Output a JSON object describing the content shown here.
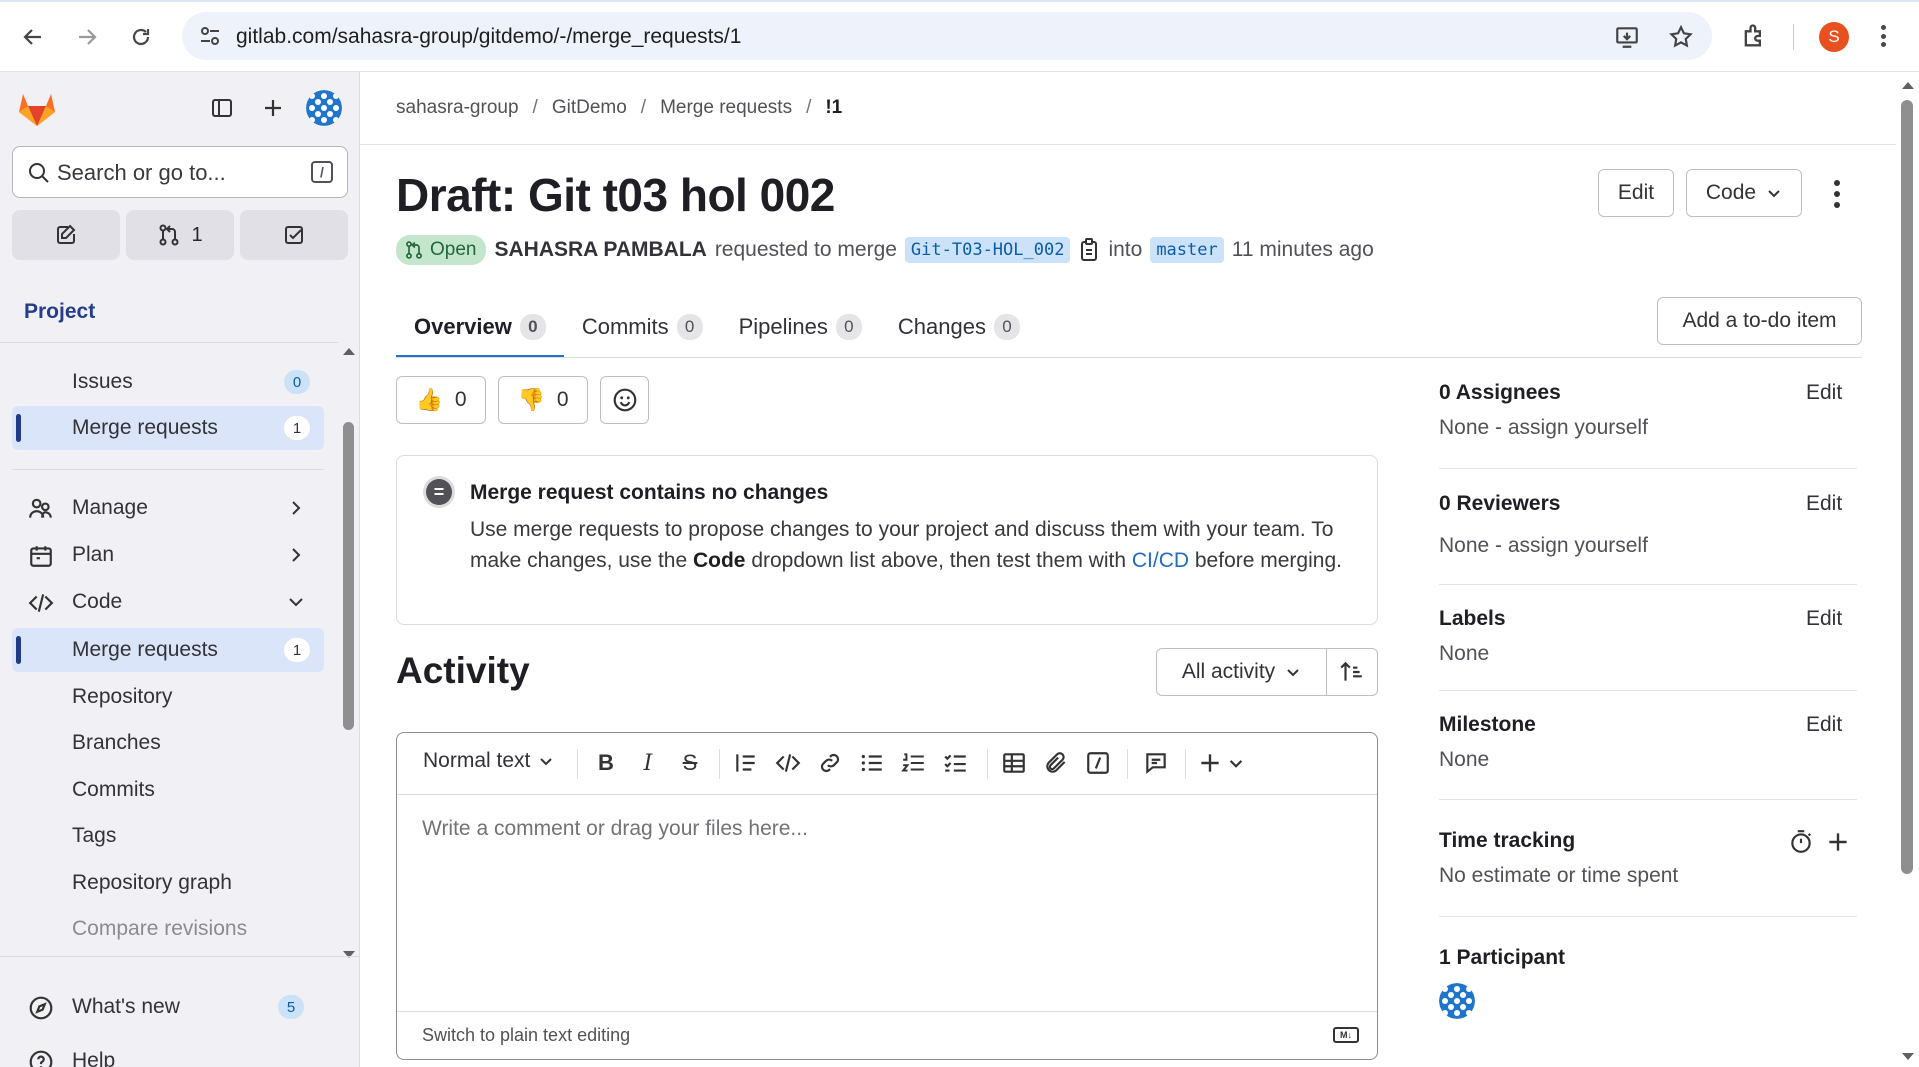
{
  "browser": {
    "url": "gitlab.com/sahasra-group/gitdemo/-/merge_requests/1",
    "profile_initial": "S",
    "icons": [
      "back-icon",
      "forward-icon",
      "reload-icon",
      "site-settings-icon",
      "install-icon",
      "bookmark-star-icon",
      "extensions-icon",
      "chrome-menu-icon"
    ]
  },
  "sidebar": {
    "search_placeholder": "Search or go to...",
    "search_shortcut": "/",
    "mr_count": "1",
    "section_label": "Project",
    "items": [
      {
        "label": "Issues",
        "badge": "0"
      },
      {
        "label": "Merge requests",
        "badge": "1"
      },
      {
        "label": "Manage"
      },
      {
        "label": "Plan"
      },
      {
        "label": "Code"
      },
      {
        "label": "Merge requests",
        "badge": "1"
      },
      {
        "label": "Repository"
      },
      {
        "label": "Branches"
      },
      {
        "label": "Commits"
      },
      {
        "label": "Tags"
      },
      {
        "label": "Repository graph"
      },
      {
        "label": "Compare revisions"
      }
    ],
    "whats_new": {
      "label": "What's new",
      "badge": "5"
    },
    "help": {
      "label": "Help"
    }
  },
  "breadcrumb": [
    "sahasra-group",
    "GitDemo",
    "Merge requests",
    "!1"
  ],
  "mr": {
    "title": "Draft: Git t03 hol 002",
    "edit_label": "Edit",
    "code_label": "Code",
    "status": "Open",
    "author": "SAHASRA PAMBALA",
    "requested_text": "requested to merge",
    "source_branch": "Git-T03-HOL_002",
    "into_text": "into",
    "target_branch": "master",
    "time": "11 minutes ago"
  },
  "tabs": [
    {
      "label": "Overview",
      "count": "0"
    },
    {
      "label": "Commits",
      "count": "0"
    },
    {
      "label": "Pipelines",
      "count": "0"
    },
    {
      "label": "Changes",
      "count": "0"
    }
  ],
  "todo_label": "Add a to-do item",
  "reactions": {
    "thumbs_up": "0",
    "thumbs_down": "0"
  },
  "no_changes": {
    "heading": "Merge request contains no changes",
    "text_1": "Use merge requests to propose changes to your project and discuss them with your team. To make changes, use the ",
    "text_bold": "Code",
    "text_2": " dropdown list above, then test them with ",
    "link": "CI/CD",
    "text_3": " before merging."
  },
  "activity": {
    "heading": "Activity",
    "filter": "All activity"
  },
  "editor": {
    "text_style": "Normal text",
    "placeholder": "Write a comment or drag your files here...",
    "switch_label": "Switch to plain text editing",
    "md_label": "M↓"
  },
  "right_sidebar": {
    "assignees": {
      "title": "0 Assignees",
      "edit": "Edit",
      "value": "None - assign yourself"
    },
    "reviewers": {
      "title": "0 Reviewers",
      "edit": "Edit",
      "value": "None - assign yourself"
    },
    "labels": {
      "title": "Labels",
      "edit": "Edit",
      "value": "None"
    },
    "milestone": {
      "title": "Milestone",
      "edit": "Edit",
      "value": "None"
    },
    "time_tracking": {
      "title": "Time tracking",
      "value": "No estimate or time spent"
    },
    "participants": {
      "title": "1 Participant"
    }
  },
  "colors": {
    "accent": "#1f75cb",
    "sidebar_bg": "#f1f0f4",
    "open_green": "#c3e6cd"
  }
}
